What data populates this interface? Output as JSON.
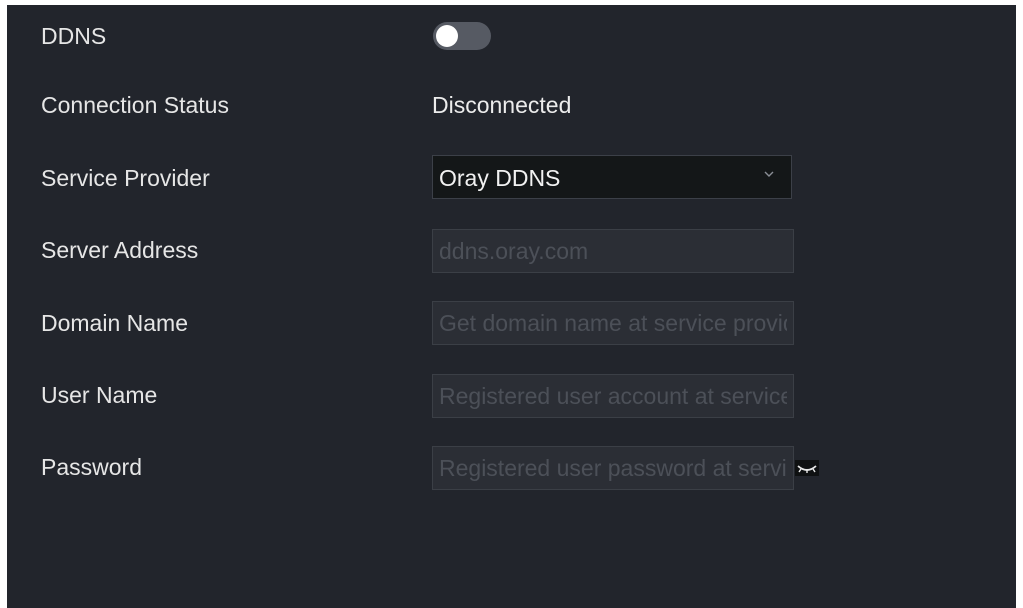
{
  "ddns": {
    "label": "DDNS",
    "enabled": false
  },
  "connection_status": {
    "label": "Connection Status",
    "value": "Disconnected"
  },
  "service_provider": {
    "label": "Service Provider",
    "selected": "Oray DDNS"
  },
  "server_address": {
    "label": "Server Address",
    "placeholder": "ddns.oray.com"
  },
  "domain_name": {
    "label": "Domain Name",
    "placeholder": "Get domain name at service provider"
  },
  "user_name": {
    "label": "User Name",
    "placeholder": "Registered user account at service provider"
  },
  "password": {
    "label": "Password",
    "placeholder": "Registered user password at service provider"
  },
  "icons": {
    "dropdown": "chevron-down-icon",
    "password_toggle": "eye-closed-icon"
  },
  "colors": {
    "panel_background": "#22252c",
    "input_background": "#2b2e35",
    "select_background": "#141718",
    "toggle_off": "#565a63",
    "text": "#e6e6e6",
    "placeholder": "#4c5058"
  }
}
